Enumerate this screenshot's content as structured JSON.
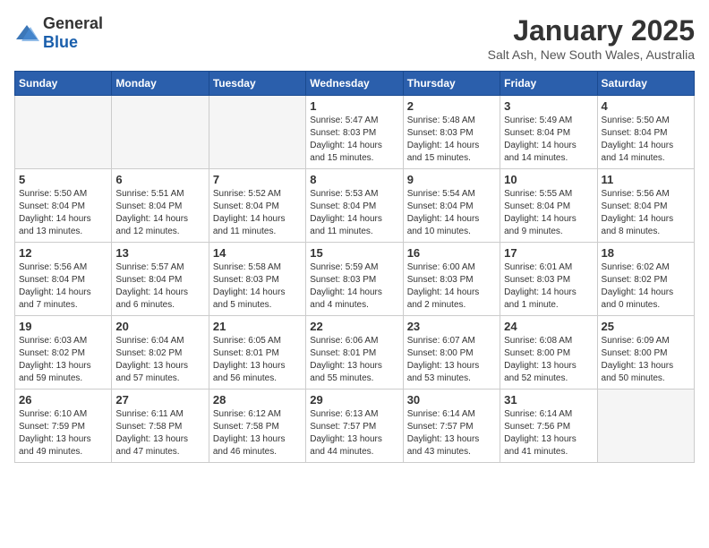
{
  "header": {
    "logo_general": "General",
    "logo_blue": "Blue",
    "title": "January 2025",
    "subtitle": "Salt Ash, New South Wales, Australia"
  },
  "days_of_week": [
    "Sunday",
    "Monday",
    "Tuesday",
    "Wednesday",
    "Thursday",
    "Friday",
    "Saturday"
  ],
  "weeks": [
    [
      {
        "day": "",
        "info": ""
      },
      {
        "day": "",
        "info": ""
      },
      {
        "day": "",
        "info": ""
      },
      {
        "day": "1",
        "info": "Sunrise: 5:47 AM\nSunset: 8:03 PM\nDaylight: 14 hours\nand 15 minutes."
      },
      {
        "day": "2",
        "info": "Sunrise: 5:48 AM\nSunset: 8:03 PM\nDaylight: 14 hours\nand 15 minutes."
      },
      {
        "day": "3",
        "info": "Sunrise: 5:49 AM\nSunset: 8:04 PM\nDaylight: 14 hours\nand 14 minutes."
      },
      {
        "day": "4",
        "info": "Sunrise: 5:50 AM\nSunset: 8:04 PM\nDaylight: 14 hours\nand 14 minutes."
      }
    ],
    [
      {
        "day": "5",
        "info": "Sunrise: 5:50 AM\nSunset: 8:04 PM\nDaylight: 14 hours\nand 13 minutes."
      },
      {
        "day": "6",
        "info": "Sunrise: 5:51 AM\nSunset: 8:04 PM\nDaylight: 14 hours\nand 12 minutes."
      },
      {
        "day": "7",
        "info": "Sunrise: 5:52 AM\nSunset: 8:04 PM\nDaylight: 14 hours\nand 11 minutes."
      },
      {
        "day": "8",
        "info": "Sunrise: 5:53 AM\nSunset: 8:04 PM\nDaylight: 14 hours\nand 11 minutes."
      },
      {
        "day": "9",
        "info": "Sunrise: 5:54 AM\nSunset: 8:04 PM\nDaylight: 14 hours\nand 10 minutes."
      },
      {
        "day": "10",
        "info": "Sunrise: 5:55 AM\nSunset: 8:04 PM\nDaylight: 14 hours\nand 9 minutes."
      },
      {
        "day": "11",
        "info": "Sunrise: 5:56 AM\nSunset: 8:04 PM\nDaylight: 14 hours\nand 8 minutes."
      }
    ],
    [
      {
        "day": "12",
        "info": "Sunrise: 5:56 AM\nSunset: 8:04 PM\nDaylight: 14 hours\nand 7 minutes."
      },
      {
        "day": "13",
        "info": "Sunrise: 5:57 AM\nSunset: 8:04 PM\nDaylight: 14 hours\nand 6 minutes."
      },
      {
        "day": "14",
        "info": "Sunrise: 5:58 AM\nSunset: 8:03 PM\nDaylight: 14 hours\nand 5 minutes."
      },
      {
        "day": "15",
        "info": "Sunrise: 5:59 AM\nSunset: 8:03 PM\nDaylight: 14 hours\nand 4 minutes."
      },
      {
        "day": "16",
        "info": "Sunrise: 6:00 AM\nSunset: 8:03 PM\nDaylight: 14 hours\nand 2 minutes."
      },
      {
        "day": "17",
        "info": "Sunrise: 6:01 AM\nSunset: 8:03 PM\nDaylight: 14 hours\nand 1 minute."
      },
      {
        "day": "18",
        "info": "Sunrise: 6:02 AM\nSunset: 8:02 PM\nDaylight: 14 hours\nand 0 minutes."
      }
    ],
    [
      {
        "day": "19",
        "info": "Sunrise: 6:03 AM\nSunset: 8:02 PM\nDaylight: 13 hours\nand 59 minutes."
      },
      {
        "day": "20",
        "info": "Sunrise: 6:04 AM\nSunset: 8:02 PM\nDaylight: 13 hours\nand 57 minutes."
      },
      {
        "day": "21",
        "info": "Sunrise: 6:05 AM\nSunset: 8:01 PM\nDaylight: 13 hours\nand 56 minutes."
      },
      {
        "day": "22",
        "info": "Sunrise: 6:06 AM\nSunset: 8:01 PM\nDaylight: 13 hours\nand 55 minutes."
      },
      {
        "day": "23",
        "info": "Sunrise: 6:07 AM\nSunset: 8:00 PM\nDaylight: 13 hours\nand 53 minutes."
      },
      {
        "day": "24",
        "info": "Sunrise: 6:08 AM\nSunset: 8:00 PM\nDaylight: 13 hours\nand 52 minutes."
      },
      {
        "day": "25",
        "info": "Sunrise: 6:09 AM\nSunset: 8:00 PM\nDaylight: 13 hours\nand 50 minutes."
      }
    ],
    [
      {
        "day": "26",
        "info": "Sunrise: 6:10 AM\nSunset: 7:59 PM\nDaylight: 13 hours\nand 49 minutes."
      },
      {
        "day": "27",
        "info": "Sunrise: 6:11 AM\nSunset: 7:58 PM\nDaylight: 13 hours\nand 47 minutes."
      },
      {
        "day": "28",
        "info": "Sunrise: 6:12 AM\nSunset: 7:58 PM\nDaylight: 13 hours\nand 46 minutes."
      },
      {
        "day": "29",
        "info": "Sunrise: 6:13 AM\nSunset: 7:57 PM\nDaylight: 13 hours\nand 44 minutes."
      },
      {
        "day": "30",
        "info": "Sunrise: 6:14 AM\nSunset: 7:57 PM\nDaylight: 13 hours\nand 43 minutes."
      },
      {
        "day": "31",
        "info": "Sunrise: 6:14 AM\nSunset: 7:56 PM\nDaylight: 13 hours\nand 41 minutes."
      },
      {
        "day": "",
        "info": ""
      }
    ]
  ]
}
